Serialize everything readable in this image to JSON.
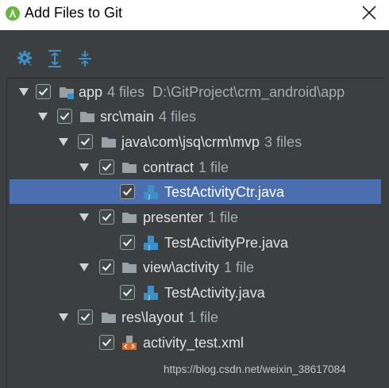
{
  "window": {
    "title": "Add Files to Git"
  },
  "toolbar": {
    "buttons": [
      "gear-icon",
      "expand-all-icon",
      "collapse-all-icon"
    ]
  },
  "tree": {
    "rows": [
      {
        "label": "app",
        "count": "4 files",
        "path": "D:\\GitProject\\crm_android\\app",
        "checked": true,
        "expanded": true,
        "icon": "module-folder-icon"
      },
      {
        "label": "src\\main",
        "count": "4 files",
        "checked": true,
        "expanded": true,
        "icon": "folder-icon"
      },
      {
        "label": "java\\com\\jsq\\crm\\mvp",
        "count": "3 files",
        "checked": true,
        "expanded": true,
        "icon": "folder-icon"
      },
      {
        "label": "contract",
        "count": "1 file",
        "checked": true,
        "expanded": true,
        "icon": "folder-icon"
      },
      {
        "label": "TestActivityCtr.java",
        "checked": true,
        "selected": true,
        "icon": "java-file-icon"
      },
      {
        "label": "presenter",
        "count": "1 file",
        "checked": true,
        "expanded": true,
        "icon": "folder-icon"
      },
      {
        "label": "TestActivityPre.java",
        "checked": true,
        "icon": "java-file-icon"
      },
      {
        "label": "view\\activity",
        "count": "1 file",
        "checked": true,
        "expanded": true,
        "icon": "folder-icon"
      },
      {
        "label": "TestActivity.java",
        "checked": true,
        "icon": "java-file-icon"
      },
      {
        "label": "res\\layout",
        "count": "1 file",
        "checked": true,
        "expanded": true,
        "icon": "folder-icon"
      },
      {
        "label": "activity_test.xml",
        "checked": true,
        "icon": "xml-file-icon"
      }
    ]
  },
  "watermark": "https://blog.csdn.net/weixin_38617084",
  "colors": {
    "selection": "#4b6eaf",
    "background": "#3c3f41",
    "text": "#dde1e4",
    "muted": "#a7acaf"
  }
}
